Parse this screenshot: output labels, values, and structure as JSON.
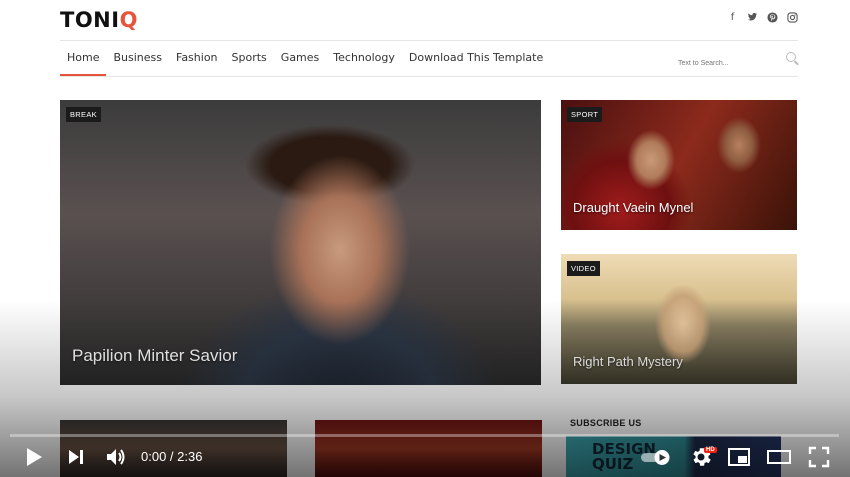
{
  "header": {
    "logo_main": "TONI",
    "logo_accent": "Q",
    "socials": [
      "facebook-icon",
      "twitter-icon",
      "pinterest-icon",
      "instagram-icon"
    ],
    "search_placeholder": "Text to Search..."
  },
  "nav": {
    "items": [
      "Home",
      "Business",
      "Fashion",
      "Sports",
      "Games",
      "Technology",
      "Download This Template"
    ],
    "active": "Home"
  },
  "featured": {
    "tag": "BREAK",
    "title": "Papilion Minter Savior"
  },
  "side_posts": [
    {
      "tag": "SPORT",
      "title": "Draught Vaein Mynel"
    },
    {
      "tag": "VIDEO",
      "title": "Right Path Mystery"
    }
  ],
  "sidebar": {
    "subscribe_heading": "SUBSCRIBE US",
    "subscribe_image_text_1": "DESIGN",
    "subscribe_image_text_2": "QUIZ"
  },
  "player": {
    "time": "0:00 / 2:36",
    "progress": 0.0,
    "hd_badge": "HD"
  },
  "colors": {
    "accent": "#e8543a",
    "progress": "#ff0000"
  }
}
